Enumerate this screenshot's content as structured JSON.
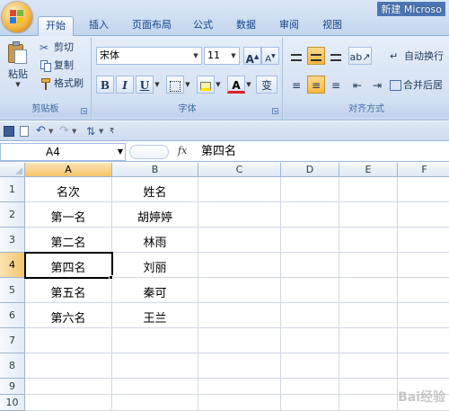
{
  "window": {
    "title": "新建 Microso"
  },
  "tabs": [
    {
      "label": "开始",
      "active": true
    },
    {
      "label": "插入"
    },
    {
      "label": "页面布局"
    },
    {
      "label": "公式"
    },
    {
      "label": "数据"
    },
    {
      "label": "审阅"
    },
    {
      "label": "视图"
    }
  ],
  "ribbon": {
    "clipboard": {
      "paste": "粘贴",
      "cut": "剪切",
      "copy": "复制",
      "format_painter": "格式刷",
      "group_label": "剪贴板"
    },
    "font": {
      "font_name": "宋体",
      "font_size": "11",
      "grow": "A",
      "shrink": "A",
      "bold": "B",
      "italic": "I",
      "underline": "U",
      "font_color_letter": "A",
      "phonetic": "变",
      "group_label": "字体"
    },
    "alignment": {
      "wrap_text": "自动换行",
      "merge_center": "合并后居",
      "group_label": "对齐方式"
    }
  },
  "formula_bar": {
    "name_box": "A4",
    "fx": "fx",
    "content": "第四名"
  },
  "sheet": {
    "columns": [
      "A",
      "B",
      "C",
      "D",
      "E",
      "F"
    ],
    "rows": [
      "1",
      "2",
      "3",
      "4",
      "5",
      "6",
      "7",
      "8",
      "9",
      "10"
    ],
    "cells": [
      [
        "名次",
        "姓名"
      ],
      [
        "第一名",
        "胡婷婷"
      ],
      [
        "第二名",
        "林雨"
      ],
      [
        "第四名",
        "刘丽"
      ],
      [
        "第五名",
        "秦可"
      ],
      [
        "第六名",
        "王兰"
      ]
    ],
    "active_cell": "A4"
  },
  "watermark": "Bai经验",
  "colors": {
    "ribbon_bg": "#d5e2f4",
    "tab_text": "#15428b",
    "header_selected": "#f5c46c",
    "gridline": "#d0d7e5"
  }
}
